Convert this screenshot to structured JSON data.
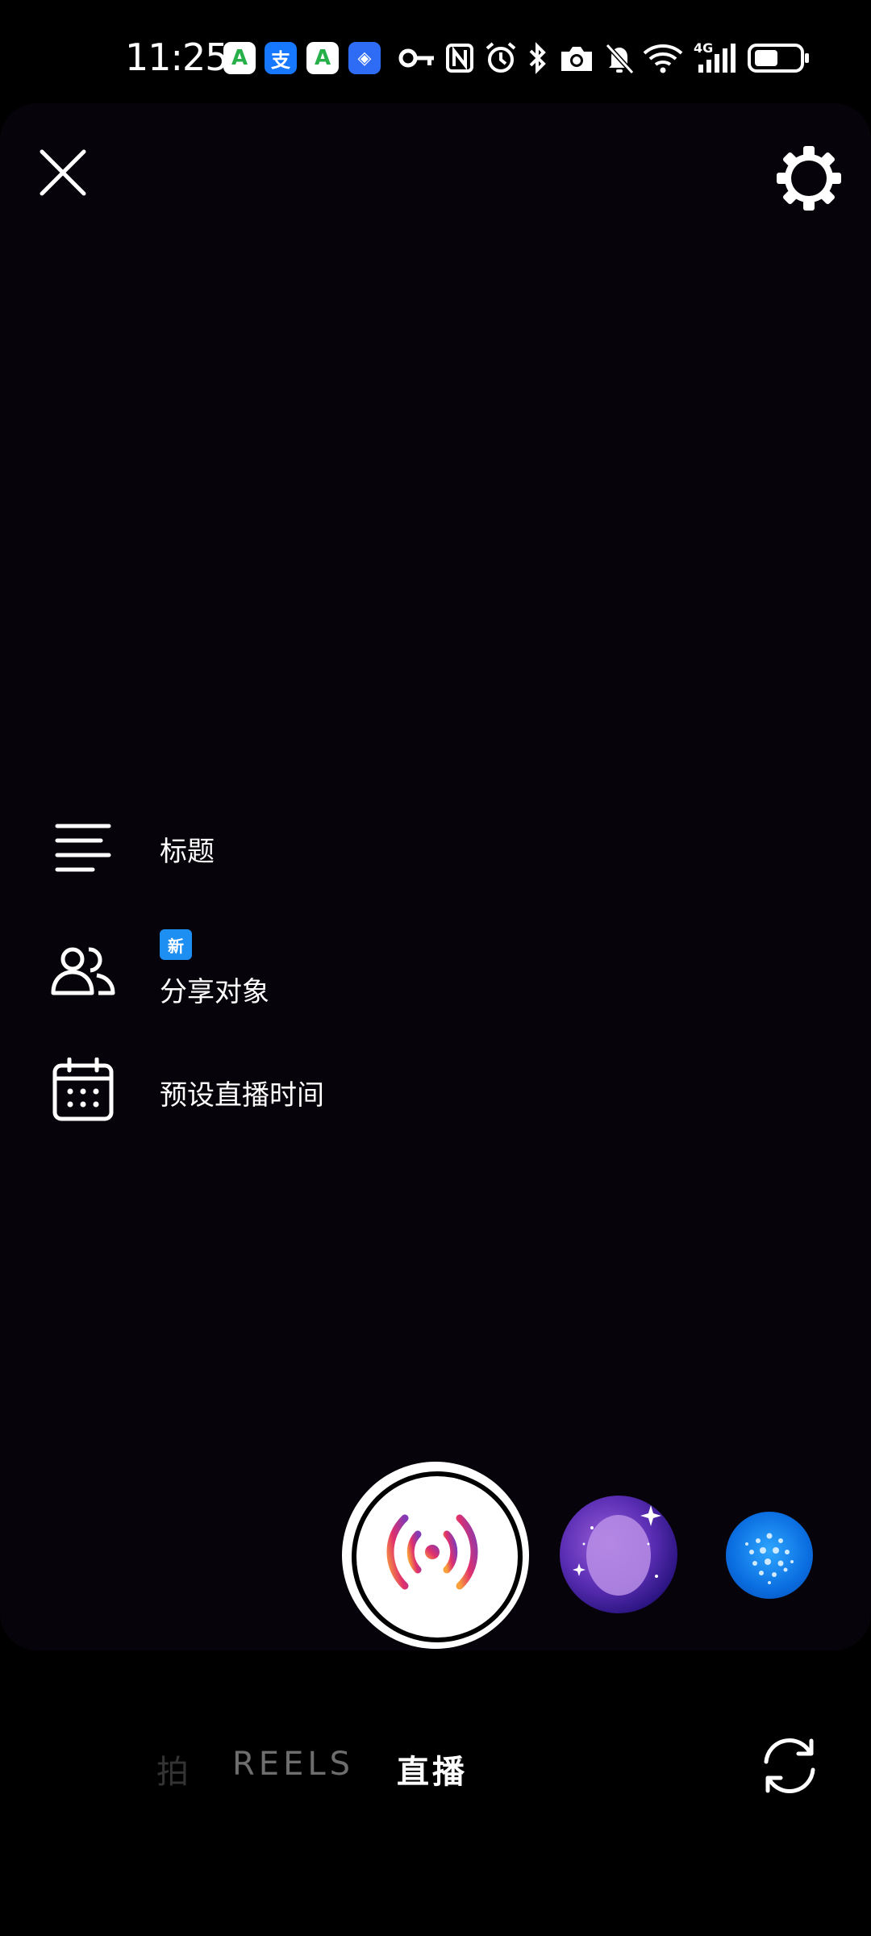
{
  "status_bar": {
    "time": "11:25",
    "app_icons": [
      {
        "name": "app-a-icon",
        "glyph": "A",
        "bg": "#ffffff",
        "fg": "#27b04a"
      },
      {
        "name": "alipay-icon",
        "glyph": "支",
        "bg": "#1677ff",
        "fg": "#ffffff"
      },
      {
        "name": "app-a-icon-2",
        "glyph": "A",
        "bg": "#ffffff",
        "fg": "#27b04a"
      },
      {
        "name": "app-shield-icon",
        "glyph": "◈",
        "bg": "#2f6cf6",
        "fg": "#ffffff"
      }
    ],
    "network_label": "4G"
  },
  "top_bar": {
    "close_icon": "close-icon",
    "settings_icon": "gear-icon"
  },
  "menu": {
    "title_label": "标题",
    "share_label": "分享对象",
    "share_badge": "新",
    "schedule_label": "预设直播时间"
  },
  "capture": {
    "live_icon": "broadcast-icon",
    "effects": [
      "face-effect-galaxy",
      "effect-sparkle-blue"
    ]
  },
  "modes": {
    "photo": "拍",
    "reels": "REELS",
    "live": "直播",
    "active": "live"
  },
  "colors": {
    "badge": "#1d8ef2",
    "background": "#000000",
    "viewport": "#07030a"
  }
}
